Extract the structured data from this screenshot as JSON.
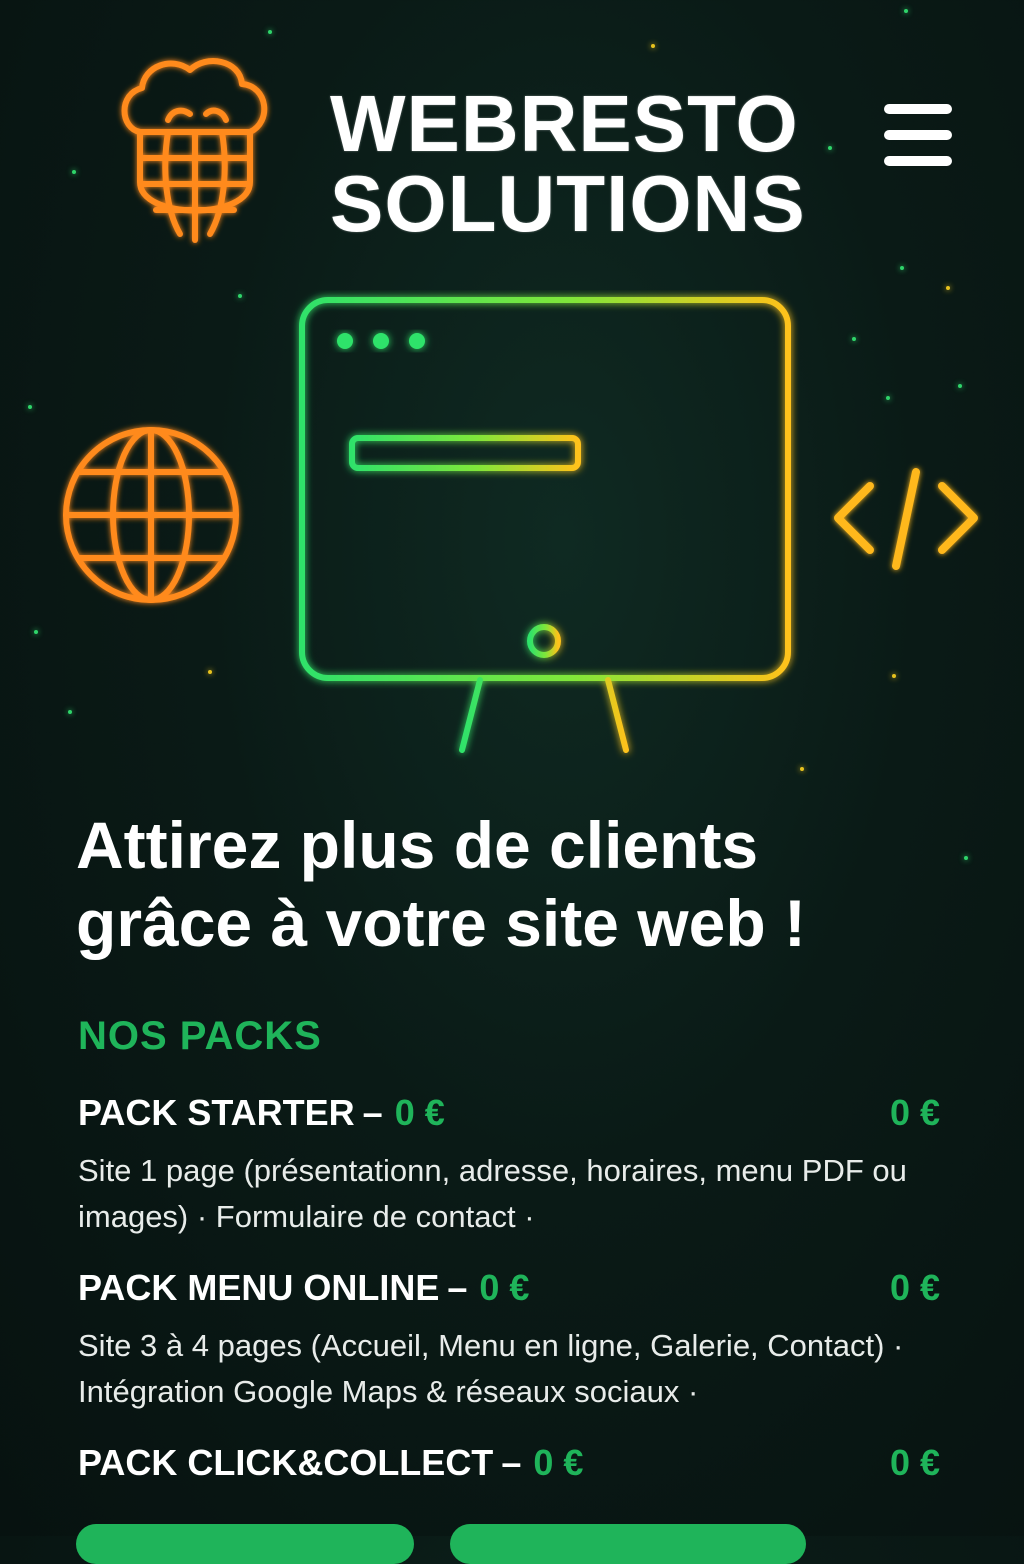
{
  "brand": {
    "line1": "WEBRESTO",
    "line2": "SOLUTIONS"
  },
  "hero": {
    "headline_line1": "Attirez plus de clients",
    "headline_line2": "grâce à votre site web !"
  },
  "packs": {
    "section_title": "NOS PACKS",
    "items": [
      {
        "name": "PACK STARTER",
        "dash": "–",
        "price": "0 €",
        "price_right": "0 €",
        "description": "Site 1 page (présentationn, adresse, horaires, menu PDF ou images) · Formulaire de contact ·"
      },
      {
        "name": "PACK MENU ONLINE",
        "dash": "–",
        "price": "0 €",
        "price_right": "0 €",
        "description": "Site 3 à 4 pages (Accueil, Menu en ligne, Galerie, Contact) · Intégration Google Maps & réseaux sociaux ·"
      },
      {
        "name": "PACK CLICK&COLLECT",
        "dash": "–",
        "price": "0 €",
        "price_right": "0 €",
        "description": ""
      }
    ]
  },
  "icons": {
    "logo": "chef-hat-globe-icon",
    "menu": "hamburger-menu-icon",
    "monitor": "monitor-icon",
    "globe": "globe-icon",
    "code": "code-icon"
  },
  "colors": {
    "background": "#0a1a16",
    "accent_green": "#1fb45a",
    "accent_orange": "#ff8a1c",
    "accent_yellow": "#e8c21e",
    "text": "#ffffff"
  }
}
